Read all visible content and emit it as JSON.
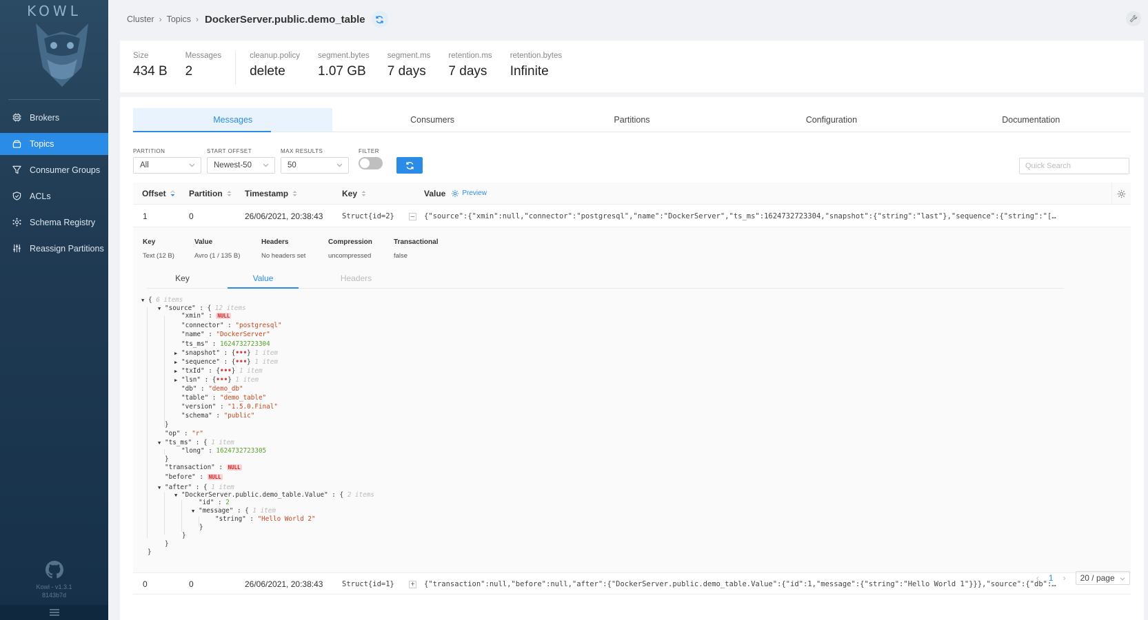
{
  "app": {
    "logo_text": "KOWL",
    "version_line1": "Kowl - v1.3.1",
    "version_line2": "8143b7d"
  },
  "sidebar": {
    "items": [
      {
        "label": "Brokers",
        "icon": "cpu-icon",
        "active": false
      },
      {
        "label": "Topics",
        "icon": "topics-icon",
        "active": true
      },
      {
        "label": "Consumer Groups",
        "icon": "funnel-icon",
        "active": false
      },
      {
        "label": "ACLs",
        "icon": "shield-icon",
        "active": false
      },
      {
        "label": "Schema Registry",
        "icon": "schema-icon",
        "active": false
      },
      {
        "label": "Reassign Partitions",
        "icon": "sliders-icon",
        "active": false
      }
    ]
  },
  "breadcrumb": {
    "cluster": "Cluster",
    "topics": "Topics",
    "title": "DockerServer.public.demo_table"
  },
  "stats": [
    {
      "label": "Size",
      "value": "434 B"
    },
    {
      "label": "Messages",
      "value": "2"
    },
    {
      "label": "cleanup.policy",
      "value": "delete"
    },
    {
      "label": "segment.bytes",
      "value": "1.07 GB"
    },
    {
      "label": "segment.ms",
      "value": "7 days"
    },
    {
      "label": "retention.ms",
      "value": "7 days"
    },
    {
      "label": "retention.bytes",
      "value": "Infinite"
    }
  ],
  "tabs": [
    "Messages",
    "Consumers",
    "Partitions",
    "Configuration",
    "Documentation"
  ],
  "filters": {
    "partition": {
      "label": "PARTITION",
      "value": "All"
    },
    "start_offset": {
      "label": "START OFFSET",
      "value": "Newest-50"
    },
    "max_results": {
      "label": "MAX RESULTS",
      "value": "50"
    },
    "filter": {
      "label": "FILTER"
    },
    "quick_search_placeholder": "Quick Search"
  },
  "table": {
    "columns": [
      "Offset",
      "Partition",
      "Timestamp",
      "Key",
      "Value"
    ],
    "preview_label": "Preview",
    "rows": [
      {
        "offset": "1",
        "partition": "0",
        "timestamp": "26/06/2021, 20:38:43",
        "key": "Struct{id=2}",
        "expander": "–",
        "value": "{\"source\":{\"xmin\":null,\"connector\":\"postgresql\",\"name\":\"DockerServer\",\"ts_ms\":1624732723304,\"snapshot\":{\"string\":\"last\"},\"sequence\":{\"string\":\"[null,\\…"
      },
      {
        "offset": "0",
        "partition": "0",
        "timestamp": "26/06/2021, 20:38:43",
        "key": "Struct{id=1}",
        "expander": "+",
        "value": "{\"transaction\":null,\"before\":null,\"after\":{\"DockerServer.public.demo_table.Value\":{\"id\":1,\"message\":{\"string\":\"Hello World 1\"}}},\"source\":{\"db\":\"demo_…"
      }
    ]
  },
  "detail": {
    "meta": [
      {
        "label": "Key",
        "value": "Text (12 B)"
      },
      {
        "label": "Value",
        "value": "Avro (1 / 135 B)"
      },
      {
        "label": "Headers",
        "value": "No headers set"
      },
      {
        "label": "Compression",
        "value": "uncompressed"
      },
      {
        "label": "Transactional",
        "value": "false"
      }
    ],
    "subtabs": [
      "Key",
      "Value",
      "Headers"
    ]
  },
  "pagination": {
    "current": "1",
    "page_size": "20 / page"
  }
}
